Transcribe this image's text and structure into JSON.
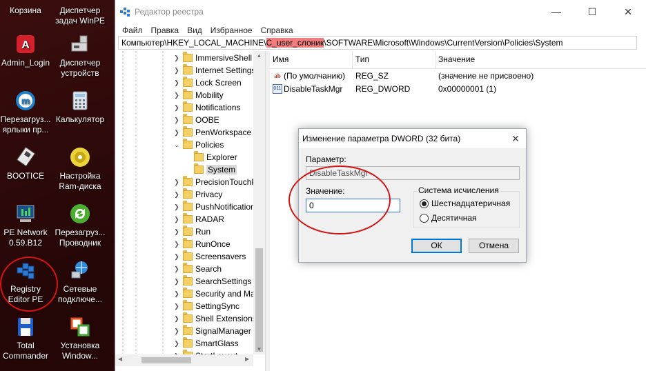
{
  "desktop": {
    "icons": [
      {
        "label": "Корзина",
        "icon": "recycle-bin-icon"
      },
      {
        "label": "Диспетчер\nзадач WinPE",
        "icon": "task-manager-icon"
      },
      {
        "label": "Admin_Login",
        "icon": "admin-login-icon"
      },
      {
        "label": "Диспетчер\nустройств",
        "icon": "device-manager-icon"
      },
      {
        "label": "Перезагруз...\nярлыки пр...",
        "icon": "reload-shortcuts-icon"
      },
      {
        "label": "Калькулятор",
        "icon": "calculator-icon"
      },
      {
        "label": "BOOTICE",
        "icon": "bootice-icon"
      },
      {
        "label": "Настройка\nRam-диска",
        "icon": "ramdisk-icon"
      },
      {
        "label": "PE Network\n0.59.B12",
        "icon": "network-icon"
      },
      {
        "label": "Перезагруз...\nПроводник",
        "icon": "reload-explorer-icon"
      },
      {
        "label": "Registry\nEditor PE",
        "icon": "registry-editor-icon"
      },
      {
        "label": "Сетевые\nподключе...",
        "icon": "network-connections-icon"
      },
      {
        "label": "Total\nCommander",
        "icon": "total-commander-icon"
      },
      {
        "label": "Установка\nWindow...",
        "icon": "windows-setup-icon"
      }
    ]
  },
  "window": {
    "title": "Редактор реестра",
    "menu": [
      "Файл",
      "Правка",
      "Вид",
      "Избранное",
      "Справка"
    ],
    "address": {
      "prefix": "Компьютер\\HKEY_LOCAL_MACHINE\\",
      "highlight": "C_user_слоник",
      "suffix": "\\SOFTWARE\\Microsoft\\Windows\\CurrentVersion\\Policies\\System"
    },
    "tree": [
      "ImmersiveShell",
      "Internet Settings",
      "Lock Screen",
      "Mobility",
      "Notifications",
      "OOBE",
      "PenWorkspace",
      "Policies",
      "Explorer",
      "System",
      "PrecisionTouchPad",
      "Privacy",
      "PushNotifications",
      "RADAR",
      "Run",
      "RunOnce",
      "Screensavers",
      "Search",
      "SearchSettings",
      "Security and Maintenance",
      "SettingSync",
      "Shell Extensions",
      "SignalManager",
      "SmartGlass",
      "StartLayout"
    ],
    "columns": {
      "name": "Имя",
      "type": "Тип",
      "value": "Значение"
    },
    "rows": [
      {
        "name": "(По умолчанию)",
        "type": "REG_SZ",
        "value": "(значение не присвоено)",
        "icon": "string-value-icon"
      },
      {
        "name": "DisableTaskMgr",
        "type": "REG_DWORD",
        "value": "0x00000001 (1)",
        "icon": "dword-value-icon"
      }
    ]
  },
  "dialog": {
    "title": "Изменение параметра DWORD (32 бита)",
    "param_label": "Параметр:",
    "param_value": "DisableTaskMgr",
    "value_label": "Значение:",
    "value": "0",
    "base_label": "Система исчисления",
    "radio_hex": "Шестнадцатеричная",
    "radio_dec": "Десятичная",
    "selected_base": "hex",
    "ok": "ОК",
    "cancel": "Отмена"
  },
  "colors": {
    "highlight": "#f47c7c",
    "annotation": "#d61414",
    "accent": "#0078d7"
  }
}
